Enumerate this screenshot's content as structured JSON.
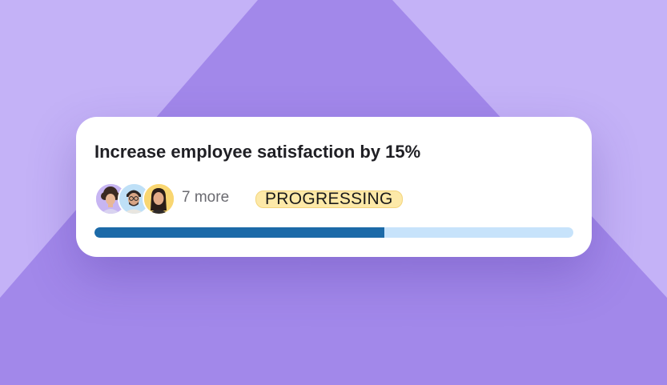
{
  "goal": {
    "title": "Increase employee satisfaction by 15%",
    "more_label": "7 more",
    "status": "PROGRESSING",
    "progress": 0.605
  },
  "avatars": [
    {
      "name": "avatar-woman-curly-hair",
      "ring_color": "#c7b5f2"
    },
    {
      "name": "avatar-man-glasses",
      "ring_color": "#bfe0f7"
    },
    {
      "name": "avatar-woman-long-hair",
      "ring_color": "#f9d671"
    }
  ],
  "colors": {
    "background": "#c4b2f7",
    "shape": "#a288ea",
    "progress_fill": "#1c6aa8",
    "progress_track": "#c7e3fb",
    "badge": "#fde9a8"
  }
}
